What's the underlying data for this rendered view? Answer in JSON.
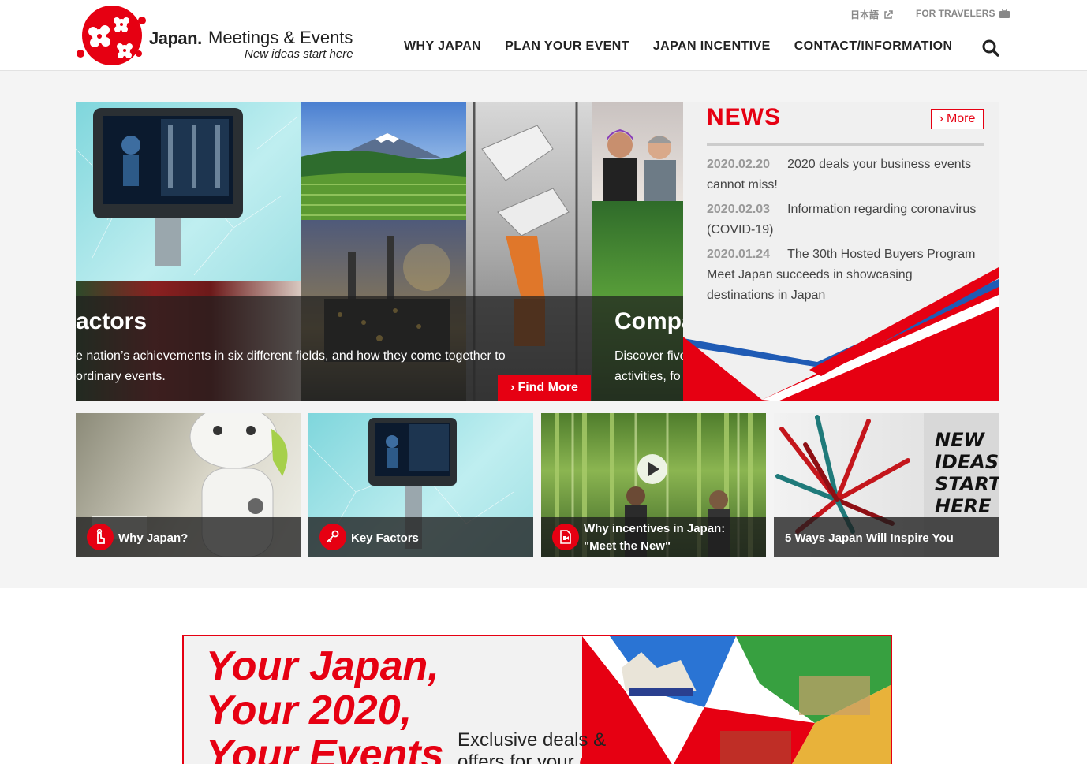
{
  "header": {
    "logo_japan": "Japan.",
    "logo_title": "Meetings & Events",
    "logo_tagline": "New ideas start here",
    "util_lang": "日本語",
    "util_travelers": "FOR TRAVELERS",
    "nav": [
      "WHY JAPAN",
      "PLAN YOUR EVENT",
      "JAPAN INCENTIVE",
      "CONTACT/INFORMATION"
    ]
  },
  "slider": {
    "title_left": "actors",
    "desc_left": "e nation’s achievements in six different fields, and how they come together to ordinary events.",
    "title_right": "Compa",
    "desc_right_1": "Discover five",
    "desc_right_2": "activities, fo",
    "cta": "Find More"
  },
  "news": {
    "heading": "NEWS",
    "more_label": "More",
    "items": [
      {
        "date": "2020.02.20",
        "text": "2020 deals your business events cannot miss!"
      },
      {
        "date": "2020.02.03",
        "text": "Information regarding coronavirus (COVID-19)"
      },
      {
        "date": "2020.01.24",
        "text": "The 30th Hosted Buyers Program Meet Japan succeeds in showcasing destinations in Japan"
      }
    ]
  },
  "cards": [
    {
      "label": "Why Japan?",
      "icon": "hand-pointer-icon"
    },
    {
      "label": "Key Factors",
      "icon": "key-icon"
    },
    {
      "label_1": "Why incentives in Japan:",
      "label_2": "\"Meet the New\"",
      "icon": "video-icon"
    },
    {
      "label": "5 Ways Japan Will Inspire You",
      "art_text": [
        "NEW",
        "IDEAS",
        "START",
        "HERE"
      ]
    }
  ],
  "banner": {
    "headline_1": "Your Japan,",
    "headline_2": "Your 2020,",
    "headline_3": "Your Events",
    "sub_1": "Exclusive deals &",
    "sub_2": "offers for your",
    "sub_red": "events"
  },
  "colors": {
    "brand_red": "#e60012",
    "nav_text": "#222222",
    "band": "#1e1e1e"
  }
}
